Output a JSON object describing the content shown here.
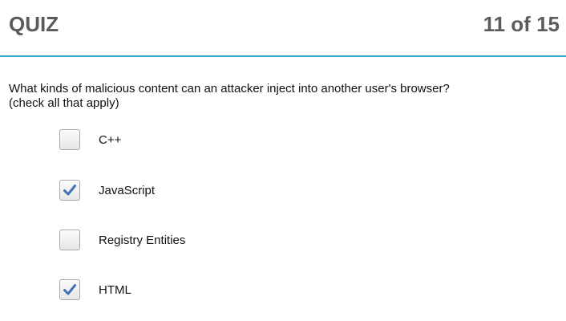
{
  "header": {
    "title": "QUIZ",
    "progress": "11 of 15",
    "accent_color": "#3aa9c9"
  },
  "question": {
    "text": "What kinds of malicious content can an attacker inject into another user's browser?",
    "instruction": "(check all that apply)"
  },
  "options": [
    {
      "label": "C++",
      "checked": false
    },
    {
      "label": "JavaScript",
      "checked": true
    },
    {
      "label": "Registry Entities",
      "checked": false
    },
    {
      "label": "HTML",
      "checked": true
    }
  ],
  "check_color": "#3f72b8"
}
